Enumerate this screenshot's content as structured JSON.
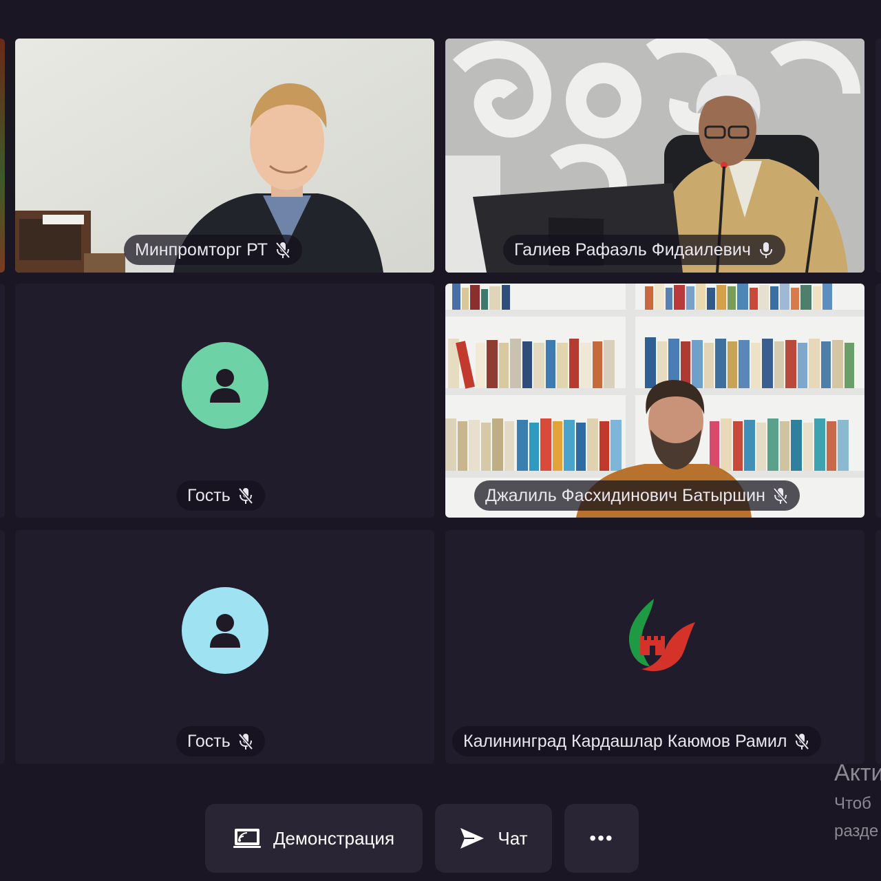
{
  "participants": [
    {
      "name": "Минпромторг РТ",
      "muted": true
    },
    {
      "name": "Галиев Рафаэль Фидаилевич",
      "muted": false,
      "speaking": true
    },
    {
      "name": "Гость",
      "muted": true,
      "avatar_color": "#6dd3a6"
    },
    {
      "name": "Джалиль Фасхидинович Батыршин",
      "muted": true
    },
    {
      "name": "Гость",
      "muted": true,
      "avatar_color": "#9fe3f3"
    },
    {
      "name": "Калининград Кардашлар Каюмов Рамил",
      "muted": true
    }
  ],
  "toolbar": {
    "demo_label": "Демонстрация",
    "chat_label": "Чат",
    "more_label": "•••"
  },
  "watermark": {
    "title": "Акти",
    "line1": "Чтоб",
    "line2": "разде"
  },
  "colors": {
    "background": "#1a1623",
    "tile": "#211c2c",
    "active_speaker": "#f3c814",
    "button": "#2a2535"
  }
}
